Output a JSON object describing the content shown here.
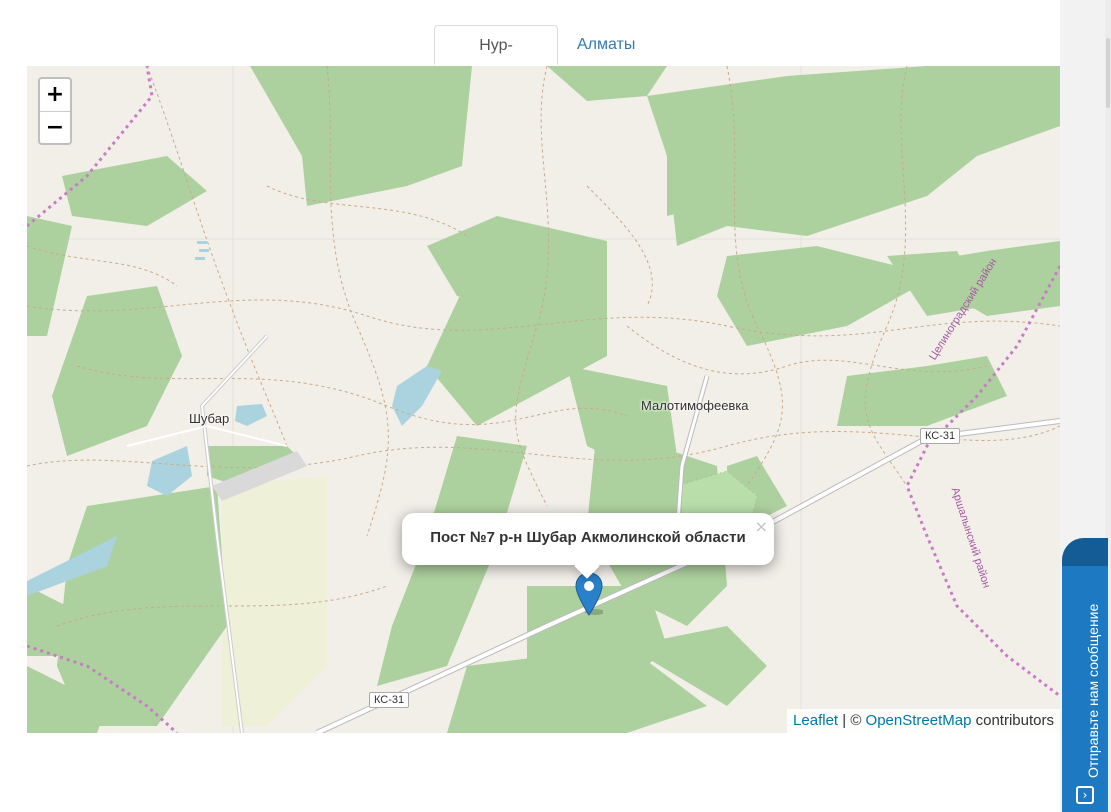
{
  "tabs": {
    "active": "Нур-Султан",
    "other": "Алматы"
  },
  "map": {
    "zoom_in": "+",
    "zoom_out": "−",
    "labels": {
      "village_shubar": "Шубар",
      "village_malotimofeevka": "Малотимофеевка",
      "road_ks31_east": "КС-31",
      "road_ks31_west": "КС-31",
      "district_tselinograd": "Целиноградский район",
      "district_arshaly": "Аршалынский район"
    },
    "popup": {
      "text": "Пост №7 р-н Шубар Акмолинской области",
      "close": "×"
    },
    "marker": "map-marker-icon",
    "attribution": {
      "leaflet": "Leaflet",
      "separator": " | © ",
      "osm": "OpenStreetMap",
      "suffix": " contributors"
    },
    "colors": {
      "land": "#f2efe9",
      "forest": "#add19e",
      "water": "#aad3df",
      "road": "#ffffff",
      "border": "#c77dc4",
      "marker": "#2a81cb"
    }
  },
  "feedback": {
    "label": "Отправьте нам сообщение",
    "icon": "chevron-right-icon"
  }
}
